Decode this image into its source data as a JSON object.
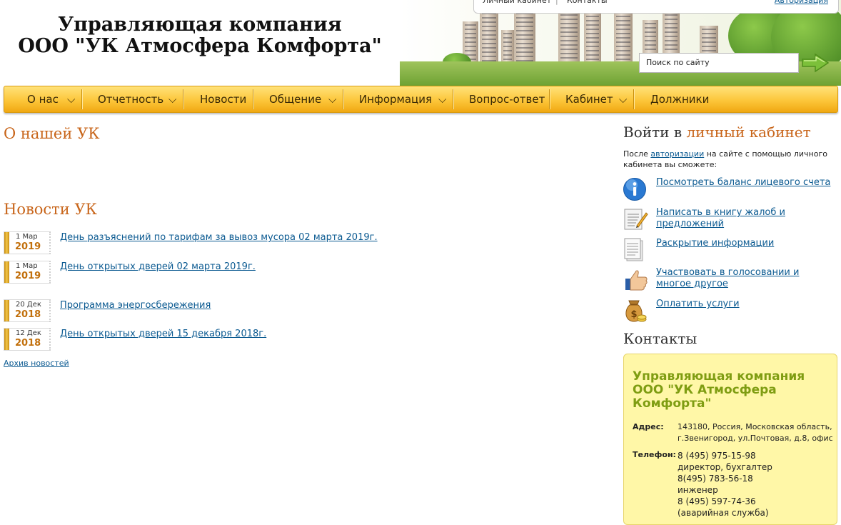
{
  "header": {
    "title_line1": "Управляющая компания",
    "title_line2": "ООО \"УК Атмосфера Комфорта\"",
    "top_links": {
      "cabinet": "Личный кабинет",
      "separator": "|",
      "contacts": "Контакты",
      "auth": "Авторизация"
    },
    "search": {
      "placeholder": "Поиск по сайту"
    }
  },
  "nav": {
    "items": [
      {
        "label": "О нас",
        "has_dropdown": true
      },
      {
        "label": "Отчетность",
        "has_dropdown": true
      },
      {
        "label": "Новости",
        "has_dropdown": false
      },
      {
        "label": "Общение",
        "has_dropdown": true
      },
      {
        "label": "Информация",
        "has_dropdown": true
      },
      {
        "label": "Вопрос-ответ",
        "has_dropdown": false
      },
      {
        "label": "Кабинет",
        "has_dropdown": true
      },
      {
        "label": "Должники",
        "has_dropdown": false
      }
    ]
  },
  "about": {
    "title": "О нашей УК"
  },
  "news": {
    "title": "Новости УК",
    "items": [
      {
        "day": "1 Мар",
        "year": "2019",
        "text": "День разъяснений по тарифам за вывоз мусора 02 марта 2019г."
      },
      {
        "day": "1 Мар",
        "year": "2019",
        "text": "День открытых дверей 02 марта 2019г."
      },
      {
        "day": "20 Дек",
        "year": "2018",
        "text": "Программа энергосбережения"
      },
      {
        "day": "12 Дек",
        "year": "2018",
        "text": "День открытых дверей 15 декабря 2018г."
      }
    ],
    "archive": "Архив новостей"
  },
  "login": {
    "title_prefix": "Войти в ",
    "title_accent": "личный кабинет",
    "desc_before": "После ",
    "desc_link": "авторизации",
    "desc_after": " на сайте с помощью личного кабинета вы сможете:",
    "features": [
      {
        "icon": "info-icon",
        "text": "Посмотреть баланс лицевого счета"
      },
      {
        "icon": "notepad-pen-icon",
        "text": "Написать в книгу жалоб и предложений"
      },
      {
        "icon": "document-icon",
        "text": "Раскрытие информации"
      },
      {
        "icon": "thumbs-up-icon",
        "text": "Участвовать в голосовании и многое другое"
      },
      {
        "icon": "money-bag-icon",
        "text": "Оплатить услуги"
      }
    ]
  },
  "contacts": {
    "title": "Контакты",
    "org": "Управляющая компания ООО \"УК Атмосфера Комфорта\"",
    "address_label": "Адрес:",
    "address": "143180, Россия, Московская область, г.Звенигород, ул.Почтовая, д.8, офис",
    "phone_label": "Телефон:",
    "phones": [
      "8 (495) 975-15-98",
      "директор, бухгалтер",
      "8(495) 783-56-18",
      "инженер",
      "8 (495) 597-74-36",
      "(аварийная служба)"
    ]
  },
  "colors": {
    "accent_orange": "#c8651a",
    "link_blue": "#0b5a91",
    "nav_yellow": "#fcc63a",
    "card_yellow": "#fff7a7",
    "org_green": "#7f9d12"
  }
}
